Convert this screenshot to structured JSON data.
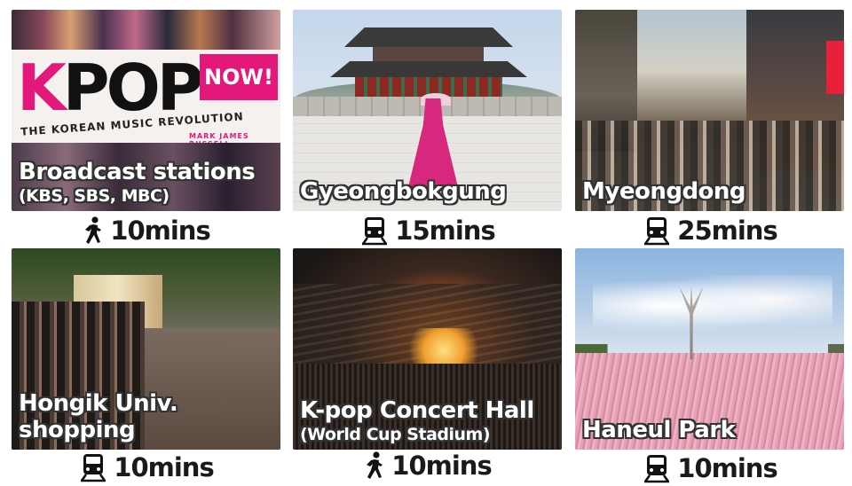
{
  "poster": {
    "title_k": "K",
    "title_pop": "POP",
    "badge": "NOW!",
    "subtitle": "THE KOREAN MUSIC REVOLUTION",
    "author": "MARK JAMES RUSSELL"
  },
  "places": [
    {
      "name_line1": "Broadcast stations",
      "name_line2": "(KBS, SBS, MBC)",
      "transport_icon": "walking-person-icon",
      "time": "10mins"
    },
    {
      "name_line1": "Gyeongbokgung",
      "name_line2": "",
      "transport_icon": "subway-train-icon",
      "time": "15mins"
    },
    {
      "name_line1": "Myeongdong",
      "name_line2": "",
      "transport_icon": "subway-train-icon",
      "time": "25mins"
    },
    {
      "name_line1": "Hongik Univ.",
      "name_line2": "shopping",
      "transport_icon": "subway-train-icon",
      "time": "10mins"
    },
    {
      "name_line1": "K-pop Concert Hall",
      "name_line2": "(World Cup Stadium)",
      "transport_icon": "walking-person-icon",
      "time": "10mins"
    },
    {
      "name_line1": "Haneul Park",
      "name_line2": "",
      "transport_icon": "subway-train-icon",
      "time": "10mins"
    }
  ]
}
